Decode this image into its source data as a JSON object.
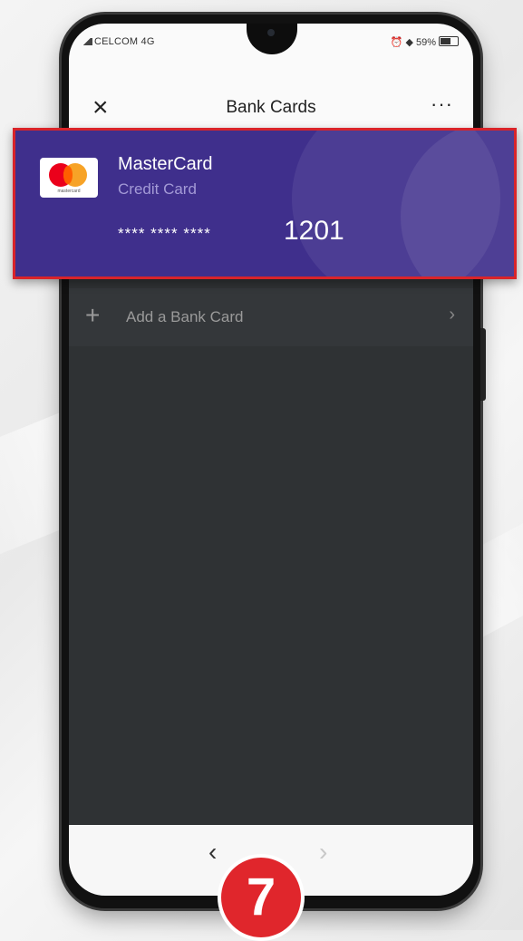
{
  "status_bar": {
    "carrier": "CELCOM  4G",
    "battery": "59%"
  },
  "header": {
    "title": "Bank Cards",
    "close_icon": "×",
    "more_icon": "···"
  },
  "card": {
    "brand_name": "MasterCard",
    "card_type": "Credit Card",
    "masked_number": "**** **** ****",
    "last_four": "1201",
    "logo_caption": "mastercard",
    "colors": {
      "background": "#3f2f8c",
      "highlight_border": "#d9242a"
    }
  },
  "add_card": {
    "plus_icon": "+",
    "label": "Add a Bank Card",
    "chevron": "›"
  },
  "nav": {
    "back": "‹",
    "forward": "›"
  },
  "step_badge": "7"
}
